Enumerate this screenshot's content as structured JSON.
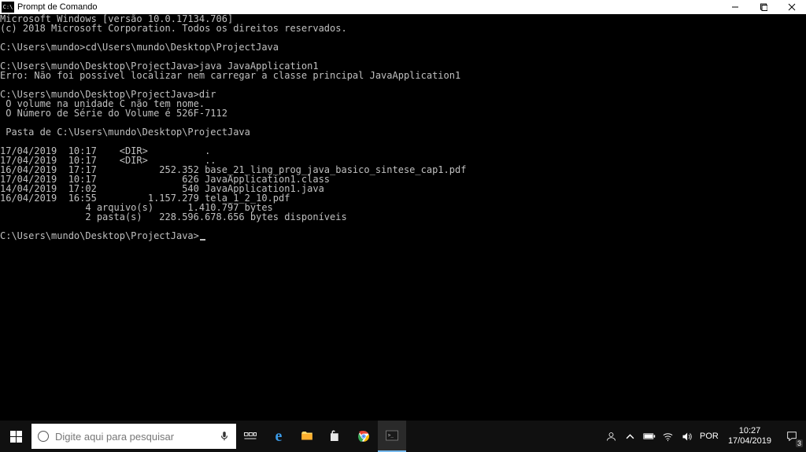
{
  "titlebar": {
    "icon_text": "C:\\",
    "title": "Prompt de Comando"
  },
  "terminal": {
    "lines": [
      "Microsoft Windows [versão 10.0.17134.706]",
      "(c) 2018 Microsoft Corporation. Todos os direitos reservados.",
      "",
      "C:\\Users\\mundo>cd\\Users\\mundo\\Desktop\\ProjectJava",
      "",
      "C:\\Users\\mundo\\Desktop\\ProjectJava>java JavaApplication1",
      "Erro: Não foi possível localizar nem carregar a classe principal JavaApplication1",
      "",
      "C:\\Users\\mundo\\Desktop\\ProjectJava>dir",
      " O volume na unidade C não tem nome.",
      " O Número de Série do Volume é 526F-7112",
      "",
      " Pasta de C:\\Users\\mundo\\Desktop\\ProjectJava",
      "",
      "17/04/2019  10:17    <DIR>          .",
      "17/04/2019  10:17    <DIR>          ..",
      "16/04/2019  17:17           252.352 base_21_ling_prog_java_basico_sintese_cap1.pdf",
      "17/04/2019  10:17               626 JavaApplication1.class",
      "14/04/2019  17:02               540 JavaApplication1.java",
      "16/04/2019  16:55         1.157.279 tela_1_2_10.pdf",
      "               4 arquivo(s)      1.410.797 bytes",
      "               2 pasta(s)   228.596.678.656 bytes disponíveis",
      "",
      "C:\\Users\\mundo\\Desktop\\ProjectJava>"
    ]
  },
  "taskbar": {
    "search_placeholder": "Digite aqui para pesquisar"
  },
  "tray": {
    "lang": "POR",
    "time": "10:27",
    "date": "17/04/2019",
    "notif_count": "3"
  }
}
